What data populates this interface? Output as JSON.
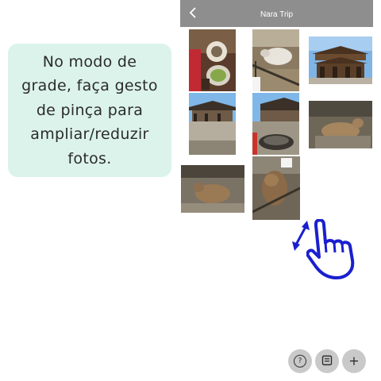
{
  "tooltip": {
    "lines": [
      "No modo de",
      "grade, faça gesto",
      "de pinça para",
      "ampliar/reduzir",
      "fotos."
    ]
  },
  "header": {
    "title": "Nara Trip",
    "back_icon": "chevron-left-icon",
    "background": "#8e8e8e"
  },
  "photos": [
    {
      "subject": "food tray with tea and dishes"
    },
    {
      "subject": "sheep in a pen"
    },
    {
      "subject": "large wooden temple gate"
    },
    {
      "subject": "temple hall courtyard"
    },
    {
      "subject": "temple courtyard with food bowl"
    },
    {
      "subject": "deer resting"
    },
    {
      "subject": "deer lying on ground"
    },
    {
      "subject": "deer close-up"
    }
  ],
  "gesture_hint": {
    "arrow_icon": "double-arrow-icon",
    "hand_icon": "pinch-hand-icon",
    "color": "#1a1fcf"
  },
  "toolbar": {
    "help_icon": "help-icon",
    "help_glyph": "?",
    "album_icon": "album-icon",
    "add_icon": "plus-icon",
    "add_glyph": "+"
  }
}
